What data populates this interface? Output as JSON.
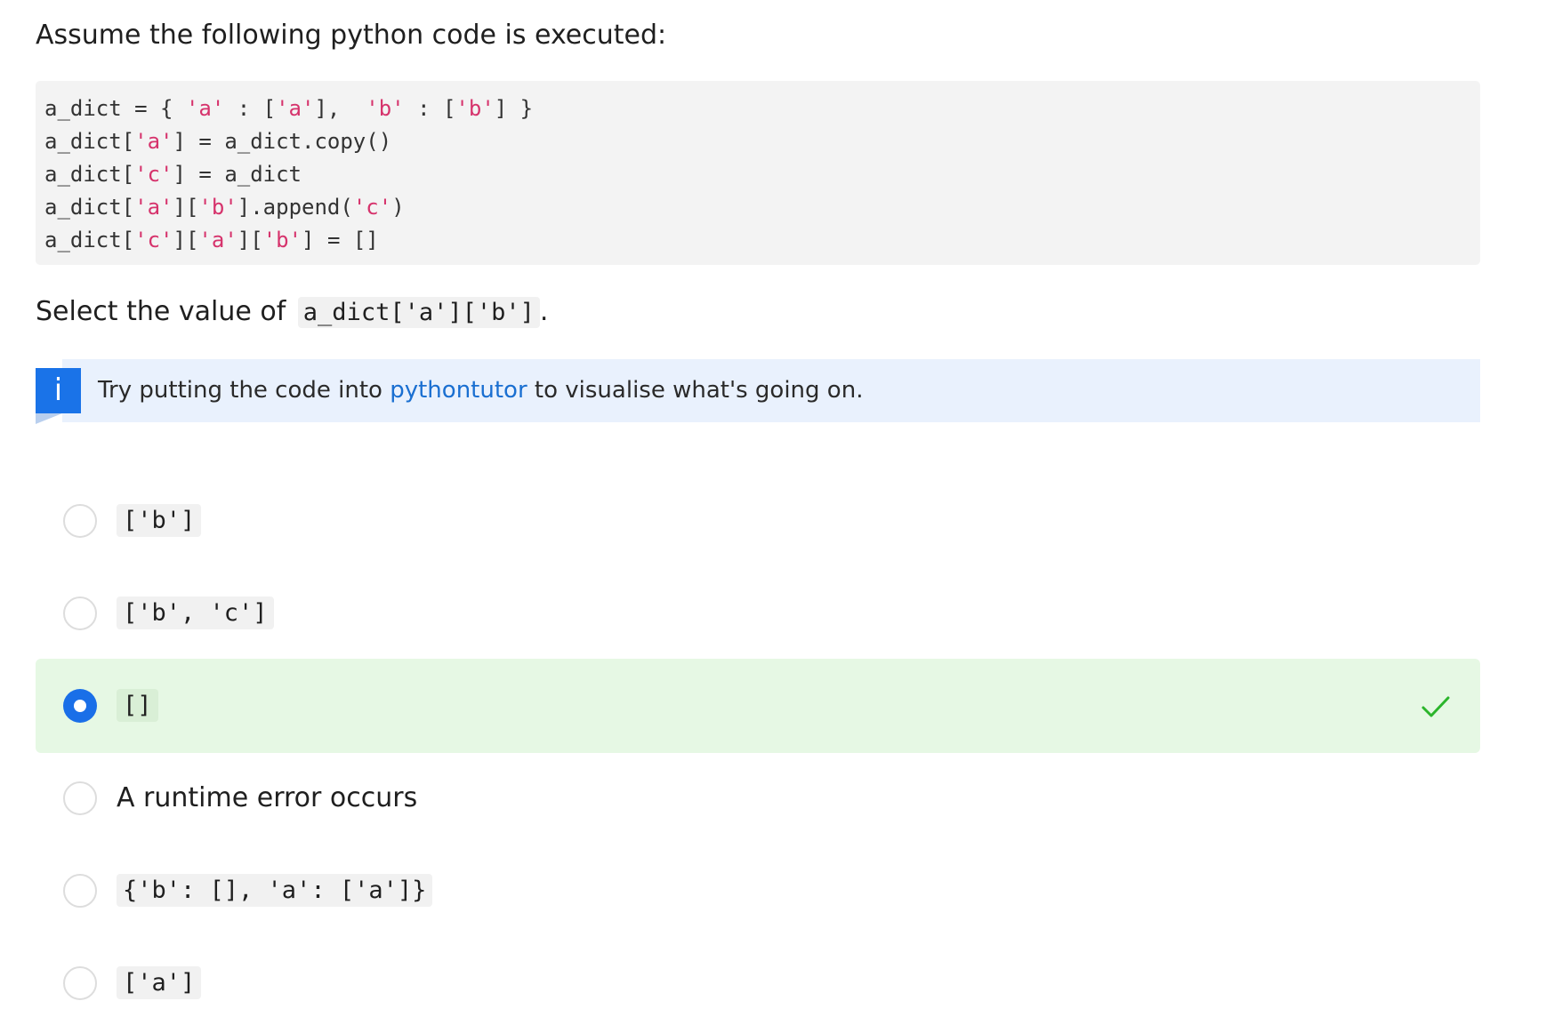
{
  "intro": "Assume the following python code is executed:",
  "code_lines": [
    "a_dict = { 'a' : ['a'],  'b' : ['b'] }",
    "a_dict['a'] = a_dict.copy()",
    "a_dict['c'] = a_dict",
    "a_dict['a']['b'].append('c')",
    "a_dict['c']['a']['b'] = []"
  ],
  "question": {
    "prefix": "Select the value of",
    "code": "a_dict['a']['b']",
    "suffix": "."
  },
  "hint": {
    "icon": "info-icon",
    "icon_glyph": "i",
    "before_link": "Try putting the code into ",
    "link_text": "pythontutor",
    "after_link": " to visualise what's going on."
  },
  "options": [
    {
      "label": "['b']",
      "is_code": true,
      "selected": false,
      "correct": false
    },
    {
      "label": "['b', 'c']",
      "is_code": true,
      "selected": false,
      "correct": false
    },
    {
      "label": "[]",
      "is_code": true,
      "selected": true,
      "correct": true
    },
    {
      "label": "A runtime error occurs",
      "is_code": false,
      "selected": false,
      "correct": false
    },
    {
      "label": "{'b': [], 'a': ['a']}",
      "is_code": true,
      "selected": false,
      "correct": false
    },
    {
      "label": "['a']",
      "is_code": true,
      "selected": false,
      "correct": false
    }
  ],
  "colors": {
    "accent": "#1a6fe8",
    "correct_bg": "#e6f8e4",
    "check": "#2bb52b",
    "string_literal": "#d6336c"
  }
}
